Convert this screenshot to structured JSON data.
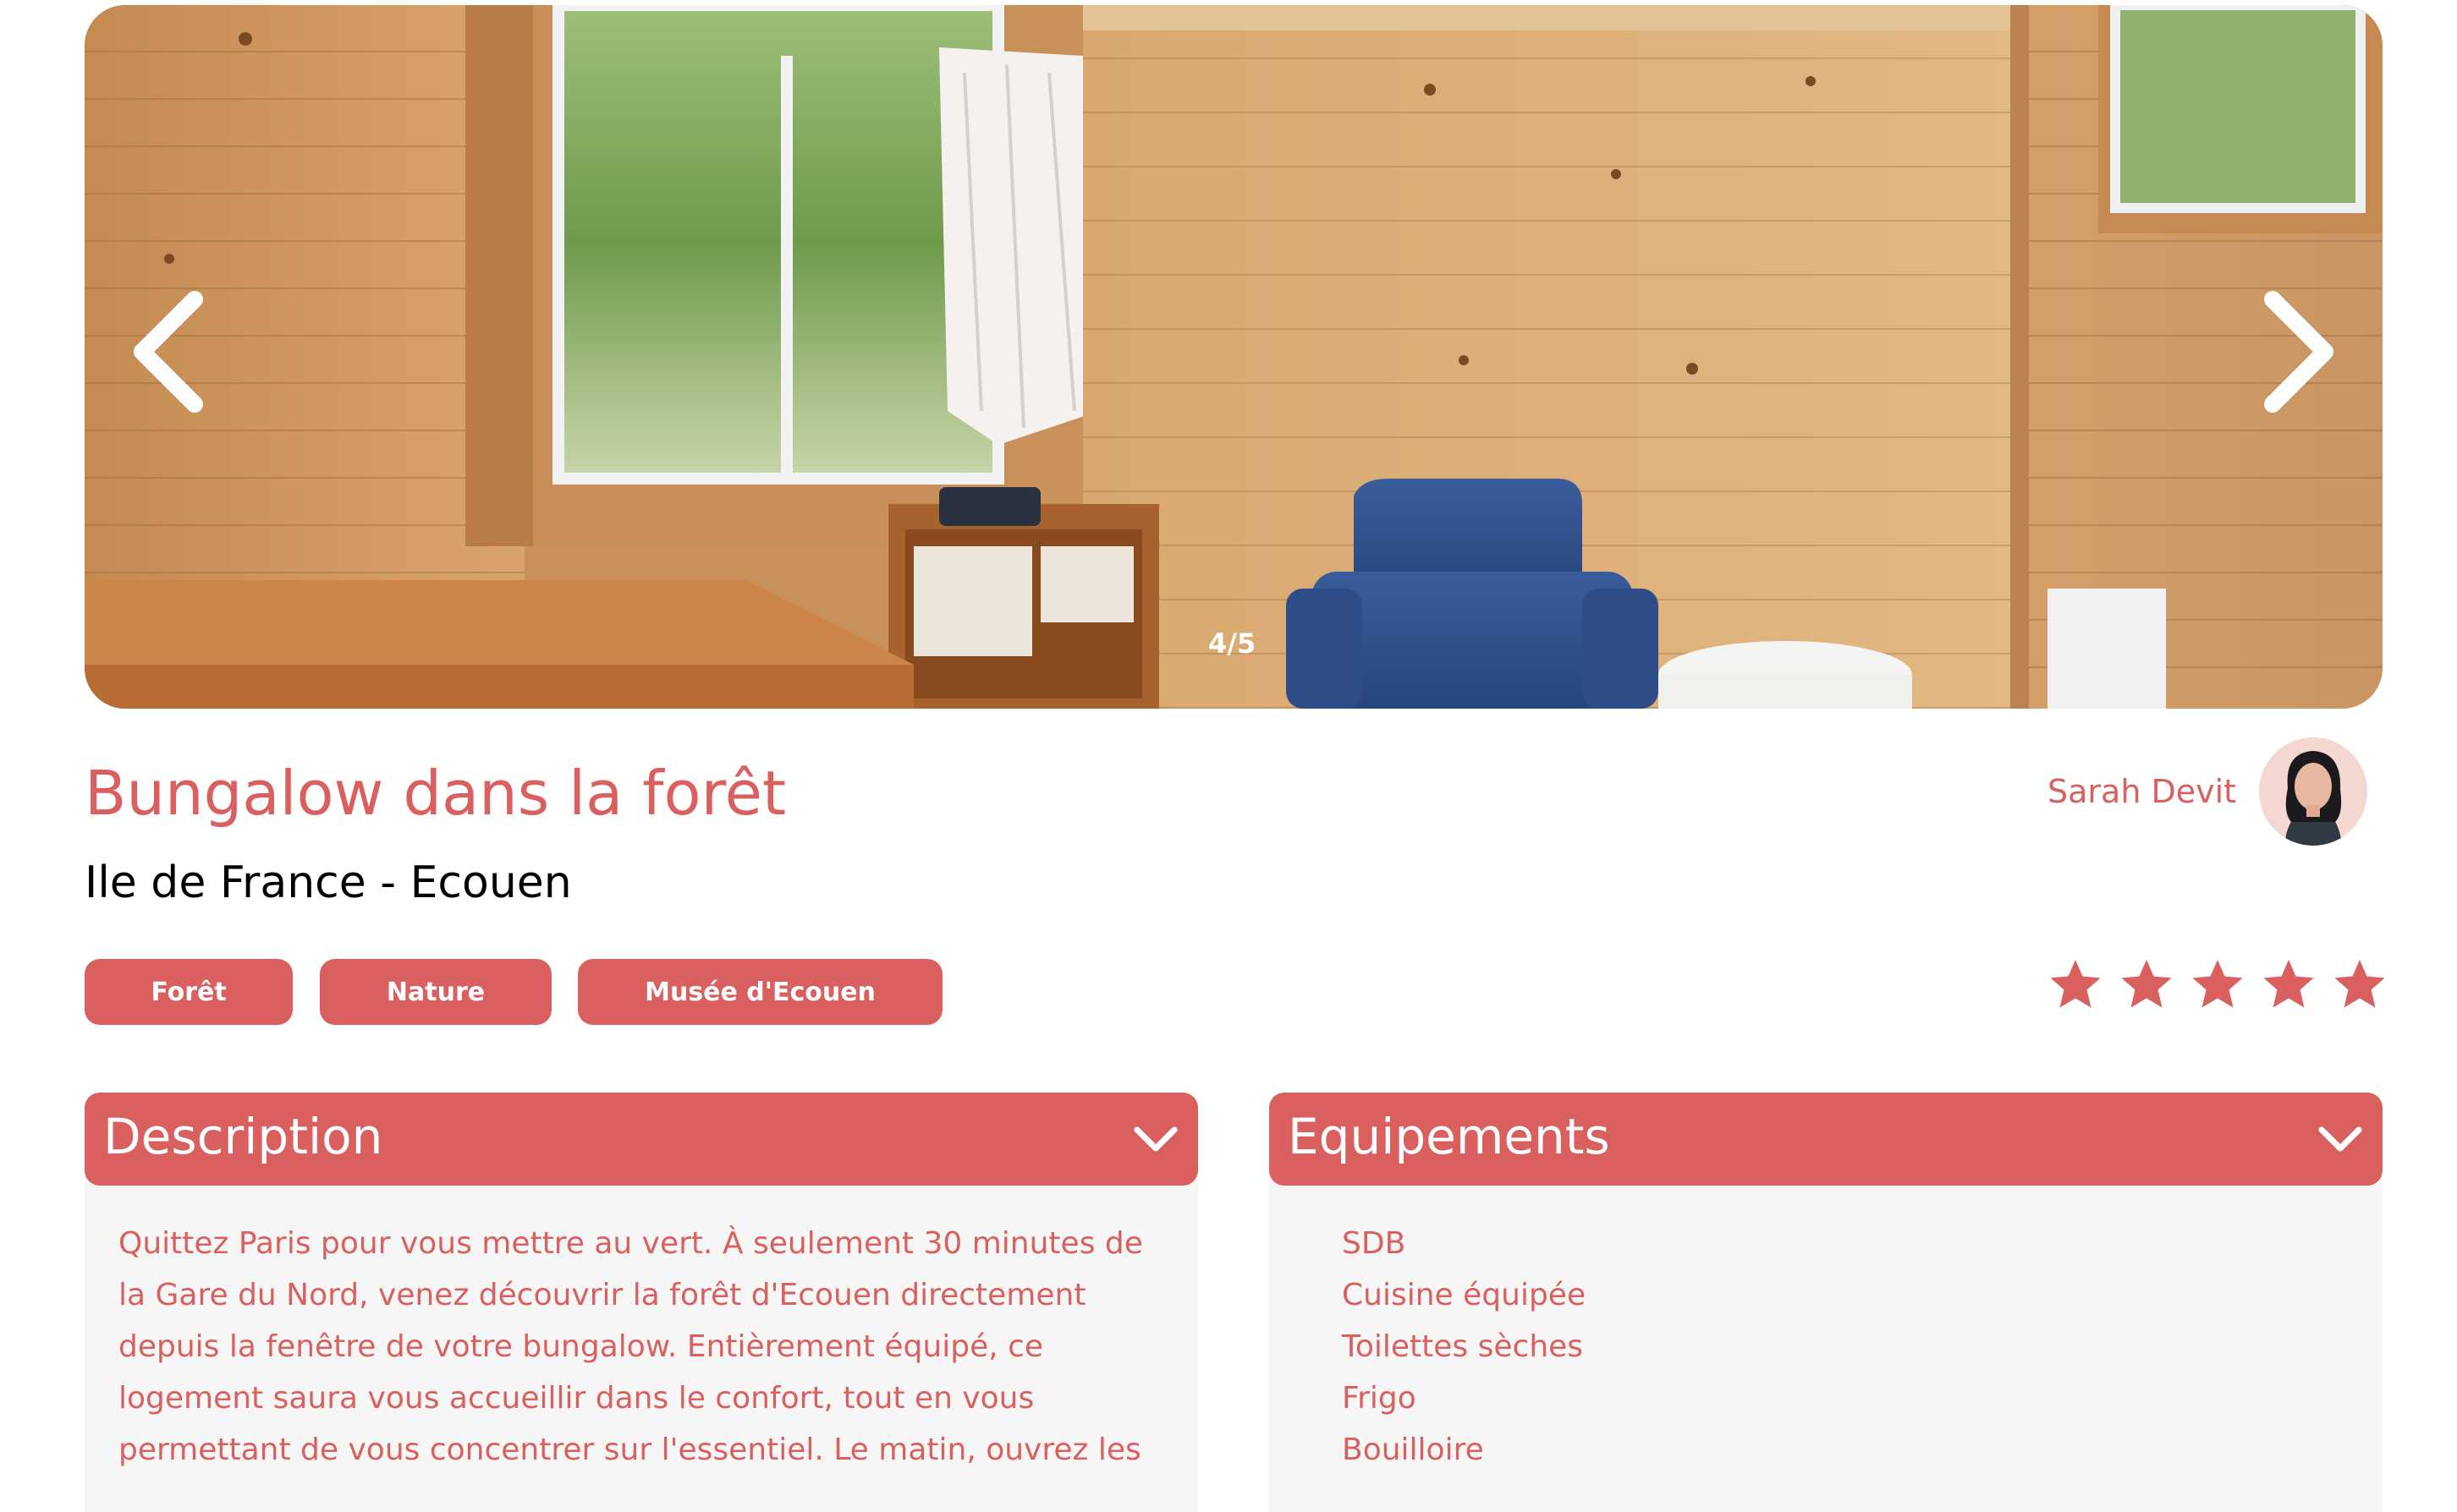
{
  "gallery": {
    "counter": "4/5",
    "prev_icon": "chevron-left-icon",
    "next_icon": "chevron-right-icon"
  },
  "listing": {
    "title": "Bungalow dans la forêt",
    "location": "Ile de France - Ecouen",
    "tags": [
      "Forêt",
      "Nature",
      "Musée d'Ecouen"
    ],
    "rating": 5,
    "rating_max": 5
  },
  "host": {
    "name": "Sarah Devit"
  },
  "panels": {
    "description": {
      "title": "Description",
      "text": "Quittez Paris pour vous mettre au vert. À seulement 30 minutes de la Gare du Nord, venez découvrir la forêt d'Ecouen directement depuis la fenêtre de votre bungalow. Entièrement équipé, ce logement saura vous accueillir dans le confort, tout en vous permettant de vous concentrer sur l'essentiel. Le matin, ouvrez les"
    },
    "equipments": {
      "title": "Equipements",
      "items": [
        "SDB",
        "Cuisine équipée",
        "Toilettes sèches",
        "Frigo",
        "Bouilloire"
      ]
    }
  },
  "colors": {
    "accent": "#d9605e",
    "panel_bg": "#f6f6f6"
  }
}
